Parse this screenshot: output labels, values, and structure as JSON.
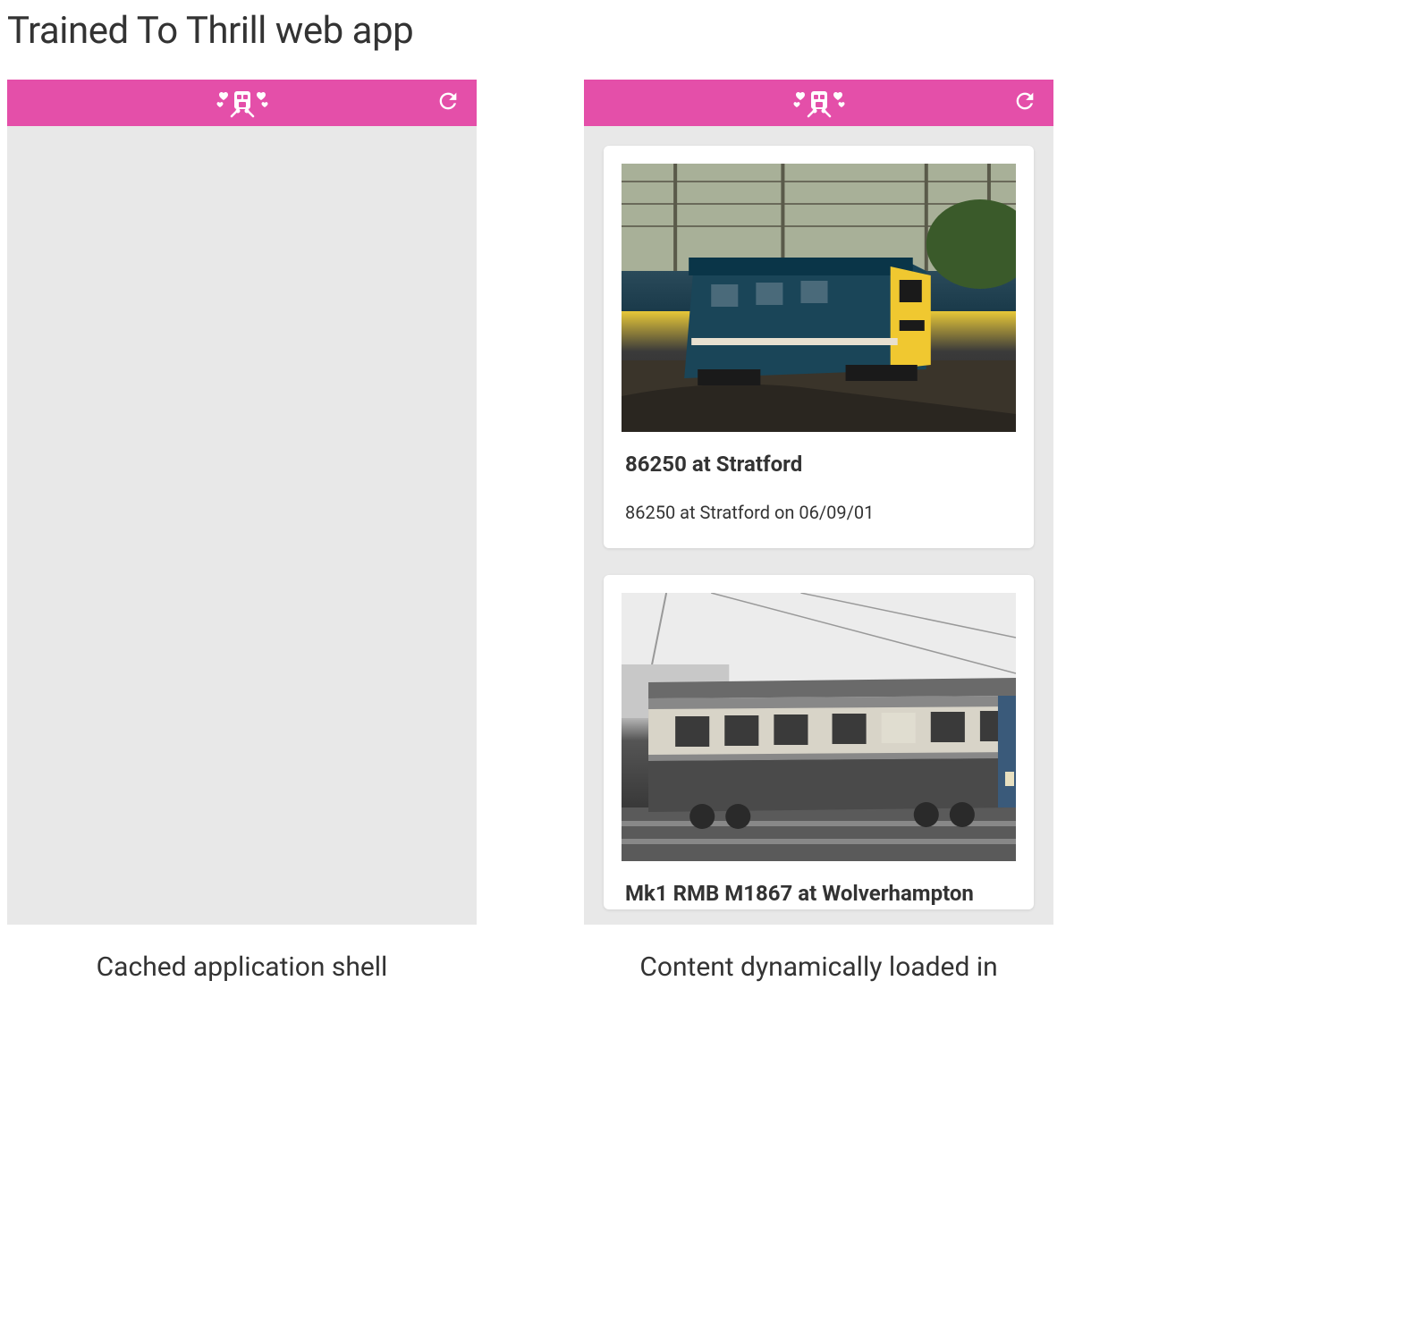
{
  "heading": "Trained To Thrill web app",
  "panels": {
    "left": {
      "caption": "Cached application shell"
    },
    "right": {
      "caption": "Content dynamically loaded in",
      "cards": [
        {
          "title": "86250 at Stratford",
          "description": "86250 at Stratford on 06/09/01"
        },
        {
          "title": "Mk1 RMB M1867 at Wolverhampton"
        }
      ]
    }
  },
  "colors": {
    "header": "#e44fa9"
  }
}
